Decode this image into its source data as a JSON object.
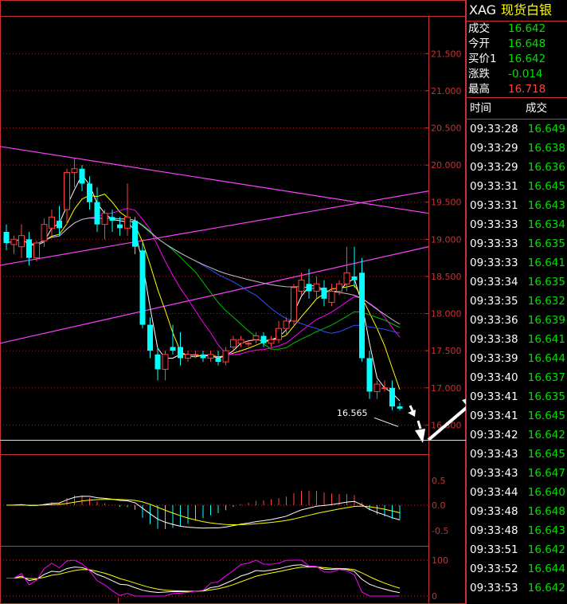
{
  "header": {
    "symbol": "XAG",
    "name": "现货白银"
  },
  "quote": [
    {
      "label": "成交",
      "value": "16.642",
      "color": "#00e000"
    },
    {
      "label": "今开",
      "value": "16.648",
      "color": "#00e000"
    },
    {
      "label": "买价1",
      "value": "16.642",
      "color": "#00e000"
    },
    {
      "label": "涨跌",
      "value": "-0.014",
      "color": "#00e000"
    },
    {
      "label": "最高",
      "value": "16.718",
      "color": "#ff4040"
    }
  ],
  "ticks_header": {
    "time": "时间",
    "price": "成交"
  },
  "ticks": [
    {
      "time": "09:33:28",
      "price": "16.649"
    },
    {
      "time": "09:33:29",
      "price": "16.638"
    },
    {
      "time": "09:33:29",
      "price": "16.636"
    },
    {
      "time": "09:33:31",
      "price": "16.645"
    },
    {
      "time": "09:33:31",
      "price": "16.643"
    },
    {
      "time": "09:33:33",
      "price": "16.634"
    },
    {
      "time": "09:33:33",
      "price": "16.635"
    },
    {
      "time": "09:33:33",
      "price": "16.641"
    },
    {
      "time": "09:33:34",
      "price": "16.635"
    },
    {
      "time": "09:33:35",
      "price": "16.632"
    },
    {
      "time": "09:33:36",
      "price": "16.639"
    },
    {
      "time": "09:33:38",
      "price": "16.641"
    },
    {
      "time": "09:33:39",
      "price": "16.644"
    },
    {
      "time": "09:33:40",
      "price": "16.637"
    },
    {
      "time": "09:33:41",
      "price": "16.635"
    },
    {
      "time": "09:33:41",
      "price": "16.645"
    },
    {
      "time": "09:33:42",
      "price": "16.642"
    },
    {
      "time": "09:33:43",
      "price": "16.645"
    },
    {
      "time": "09:33:43",
      "price": "16.647"
    },
    {
      "time": "09:33:44",
      "price": "16.640"
    },
    {
      "time": "09:33:48",
      "price": "16.648"
    },
    {
      "time": "09:33:48",
      "price": "16.643"
    },
    {
      "time": "09:33:51",
      "price": "16.642"
    },
    {
      "time": "09:33:52",
      "price": "16.644"
    },
    {
      "time": "09:33:53",
      "price": "16.642"
    }
  ],
  "colors": {
    "up": "#ff4040",
    "down": "#00ffff",
    "grid": "#c83232",
    "ma1": "#ffffff",
    "ma2": "#ffff00",
    "ma3": "#ff00ff",
    "ma4": "#00c000",
    "ma5": "#3050ff",
    "ma6": "#c0c0c0",
    "trend": "#ff40ff"
  },
  "chart_data": {
    "type": "candlestick",
    "ylim": [
      16.3,
      21.9
    ],
    "yticks": [
      "21.500",
      "21.000",
      "20.500",
      "20.000",
      "19.500",
      "19.000",
      "18.500",
      "18.000",
      "17.500",
      "17.000",
      "16.500"
    ],
    "low_annotation": "16.565",
    "candles": [
      {
        "o": 19.1,
        "h": 19.2,
        "l": 18.85,
        "c": 18.95
      },
      {
        "o": 18.93,
        "h": 19.05,
        "l": 18.8,
        "c": 19.0
      },
      {
        "o": 18.9,
        "h": 19.2,
        "l": 18.75,
        "c": 19.05
      },
      {
        "o": 19.0,
        "h": 19.1,
        "l": 18.65,
        "c": 18.75
      },
      {
        "o": 18.75,
        "h": 18.98,
        "l": 18.7,
        "c": 18.95
      },
      {
        "o": 18.98,
        "h": 19.28,
        "l": 18.9,
        "c": 19.2
      },
      {
        "o": 19.15,
        "h": 19.4,
        "l": 19.05,
        "c": 19.3
      },
      {
        "o": 19.25,
        "h": 19.45,
        "l": 19.05,
        "c": 19.15
      },
      {
        "o": 19.4,
        "h": 19.95,
        "l": 19.2,
        "c": 19.9
      },
      {
        "o": 19.9,
        "h": 20.1,
        "l": 19.7,
        "c": 19.95
      },
      {
        "o": 19.95,
        "h": 20.0,
        "l": 19.65,
        "c": 19.75
      },
      {
        "o": 19.75,
        "h": 19.85,
        "l": 19.4,
        "c": 19.5
      },
      {
        "o": 19.5,
        "h": 19.7,
        "l": 19.1,
        "c": 19.2
      },
      {
        "o": 19.2,
        "h": 19.4,
        "l": 19.0,
        "c": 19.35
      },
      {
        "o": 19.3,
        "h": 19.4,
        "l": 19.1,
        "c": 19.25
      },
      {
        "o": 19.2,
        "h": 19.3,
        "l": 19.05,
        "c": 19.15
      },
      {
        "o": 19.15,
        "h": 19.75,
        "l": 19.05,
        "c": 19.3
      },
      {
        "o": 19.25,
        "h": 19.3,
        "l": 18.8,
        "c": 18.9
      },
      {
        "o": 18.85,
        "h": 18.95,
        "l": 17.8,
        "c": 17.85
      },
      {
        "o": 17.85,
        "h": 17.95,
        "l": 17.4,
        "c": 17.5
      },
      {
        "o": 17.45,
        "h": 17.55,
        "l": 17.1,
        "c": 17.25
      },
      {
        "o": 17.25,
        "h": 17.5,
        "l": 17.1,
        "c": 17.45
      },
      {
        "o": 17.55,
        "h": 17.85,
        "l": 17.45,
        "c": 17.5
      },
      {
        "o": 17.55,
        "h": 17.75,
        "l": 17.3,
        "c": 17.4
      },
      {
        "o": 17.4,
        "h": 17.5,
        "l": 17.35,
        "c": 17.45
      },
      {
        "o": 17.45,
        "h": 17.5,
        "l": 17.4,
        "c": 17.45
      },
      {
        "o": 17.45,
        "h": 17.5,
        "l": 17.35,
        "c": 17.4
      },
      {
        "o": 17.4,
        "h": 17.5,
        "l": 17.35,
        "c": 17.45
      },
      {
        "o": 17.4,
        "h": 17.5,
        "l": 17.3,
        "c": 17.35
      },
      {
        "o": 17.35,
        "h": 17.55,
        "l": 17.3,
        "c": 17.5
      },
      {
        "o": 17.55,
        "h": 17.7,
        "l": 17.5,
        "c": 17.65
      },
      {
        "o": 17.6,
        "h": 17.7,
        "l": 17.55,
        "c": 17.65
      },
      {
        "o": 17.6,
        "h": 17.65,
        "l": 17.55,
        "c": 17.6
      },
      {
        "o": 17.65,
        "h": 17.75,
        "l": 17.6,
        "c": 17.7
      },
      {
        "o": 17.7,
        "h": 17.75,
        "l": 17.55,
        "c": 17.6
      },
      {
        "o": 17.6,
        "h": 17.7,
        "l": 17.55,
        "c": 17.65
      },
      {
        "o": 17.65,
        "h": 17.9,
        "l": 17.6,
        "c": 17.8
      },
      {
        "o": 17.8,
        "h": 17.95,
        "l": 17.7,
        "c": 17.9
      },
      {
        "o": 17.9,
        "h": 18.4,
        "l": 17.85,
        "c": 18.35
      },
      {
        "o": 18.3,
        "h": 18.55,
        "l": 18.25,
        "c": 18.45
      },
      {
        "o": 18.4,
        "h": 18.6,
        "l": 18.2,
        "c": 18.3
      },
      {
        "o": 18.3,
        "h": 18.5,
        "l": 18.2,
        "c": 18.4
      },
      {
        "o": 18.35,
        "h": 18.45,
        "l": 18.1,
        "c": 18.2
      },
      {
        "o": 18.15,
        "h": 18.4,
        "l": 18.1,
        "c": 18.3
      },
      {
        "o": 18.3,
        "h": 18.45,
        "l": 18.25,
        "c": 18.4
      },
      {
        "o": 18.4,
        "h": 18.9,
        "l": 18.3,
        "c": 18.55
      },
      {
        "o": 18.5,
        "h": 18.9,
        "l": 18.35,
        "c": 18.45
      },
      {
        "o": 18.55,
        "h": 18.75,
        "l": 17.35,
        "c": 17.4
      },
      {
        "o": 17.4,
        "h": 17.5,
        "l": 16.85,
        "c": 16.95
      },
      {
        "o": 16.95,
        "h": 17.1,
        "l": 16.85,
        "c": 17.05
      },
      {
        "o": 17.0,
        "h": 17.1,
        "l": 16.95,
        "c": 17.0
      },
      {
        "o": 17.0,
        "h": 17.1,
        "l": 16.7,
        "c": 16.75
      },
      {
        "o": 16.75,
        "h": 16.8,
        "l": 16.7,
        "c": 16.72
      }
    ]
  }
}
